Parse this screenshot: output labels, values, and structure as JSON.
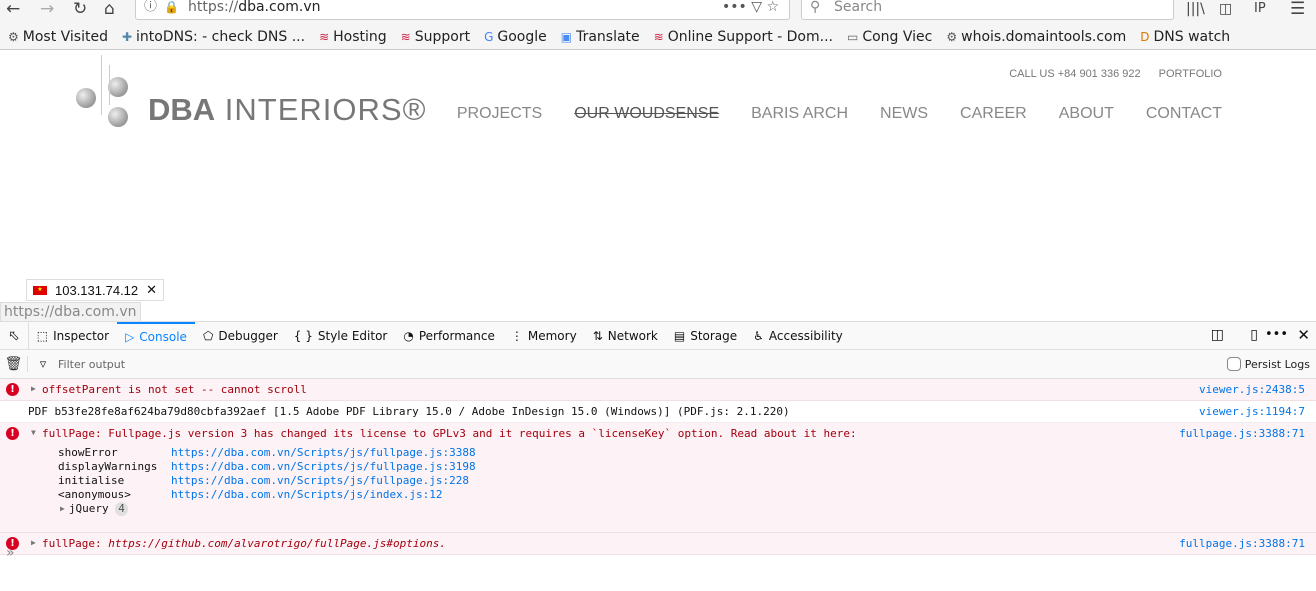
{
  "browser": {
    "url_prefix": "https://",
    "url_host": "dba.com.vn",
    "search_placeholder": "Search",
    "bookmarks": [
      {
        "label": "Most Visited",
        "icon": "gear-icon"
      },
      {
        "label": "intoDNS: - check DNS ...",
        "icon": "intodns-icon"
      },
      {
        "label": "Hosting",
        "icon": "pa-icon"
      },
      {
        "label": "Support",
        "icon": "pa-icon"
      },
      {
        "label": "Google",
        "icon": "google-icon"
      },
      {
        "label": "Translate",
        "icon": "translate-icon"
      },
      {
        "label": "Online Support - Dom...",
        "icon": "pa-icon"
      },
      {
        "label": "Cong Viec",
        "icon": "folder-icon"
      },
      {
        "label": "whois.domaintools.com",
        "icon": "gear-icon"
      },
      {
        "label": "DNS watch",
        "icon": "d-icon"
      }
    ]
  },
  "site": {
    "logo_bold": "DBA",
    "logo_light": " INTERIORS®",
    "top_links": [
      "CALL US +84 901 336 922",
      "PORTFOLIO"
    ],
    "nav": [
      "PROJECTS",
      "OUR WOUDSENSE",
      "BARIS ARCH",
      "NEWS",
      "CAREER",
      "ABOUT",
      "CONTACT"
    ],
    "ip": "103.131.74.12",
    "status_url": "https://dba.com.vn"
  },
  "devtools": {
    "tabs": [
      "Inspector",
      "Console",
      "Debugger",
      "Style Editor",
      "Performance",
      "Memory",
      "Network",
      "Storage",
      "Accessibility"
    ],
    "selected_tab": "Console",
    "filter_placeholder": "Filter output",
    "persist_logs": "Persist Logs",
    "messages": [
      {
        "type": "error",
        "text": "offsetParent is not set -- cannot scroll",
        "loc": "viewer.js:2438:5"
      },
      {
        "type": "log",
        "text": "PDF b53fe28fe8af624ba79d80cbfa392aef [1.5 Adobe PDF Library 15.0 / Adobe InDesign 15.0 (Windows)] (PDF.js: 2.1.220)",
        "loc": "viewer.js:1194:7"
      },
      {
        "type": "error",
        "text": "fullPage: Fullpage.js version 3 has changed its license to GPLv3 and it requires a `licenseKey` option. Read about it here:",
        "loc": "fullpage.js:3388:71",
        "stack": [
          {
            "fn": "showError",
            "url": "https://dba.com.vn/Scripts/js/fullpage.js:3388"
          },
          {
            "fn": "displayWarnings",
            "url": "https://dba.com.vn/Scripts/js/fullpage.js:3198"
          },
          {
            "fn": "initialise",
            "url": "https://dba.com.vn/Scripts/js/fullpage.js:228"
          },
          {
            "fn": "<anonymous>",
            "url": "https://dba.com.vn/Scripts/js/index.js:12"
          }
        ],
        "group": "jQuery",
        "group_count": "4"
      },
      {
        "type": "error",
        "prefix": "fullPage: ",
        "text": "https://github.com/alvarotrigo/fullPage.js#options.",
        "loc": "fullpage.js:3388:71"
      }
    ]
  }
}
